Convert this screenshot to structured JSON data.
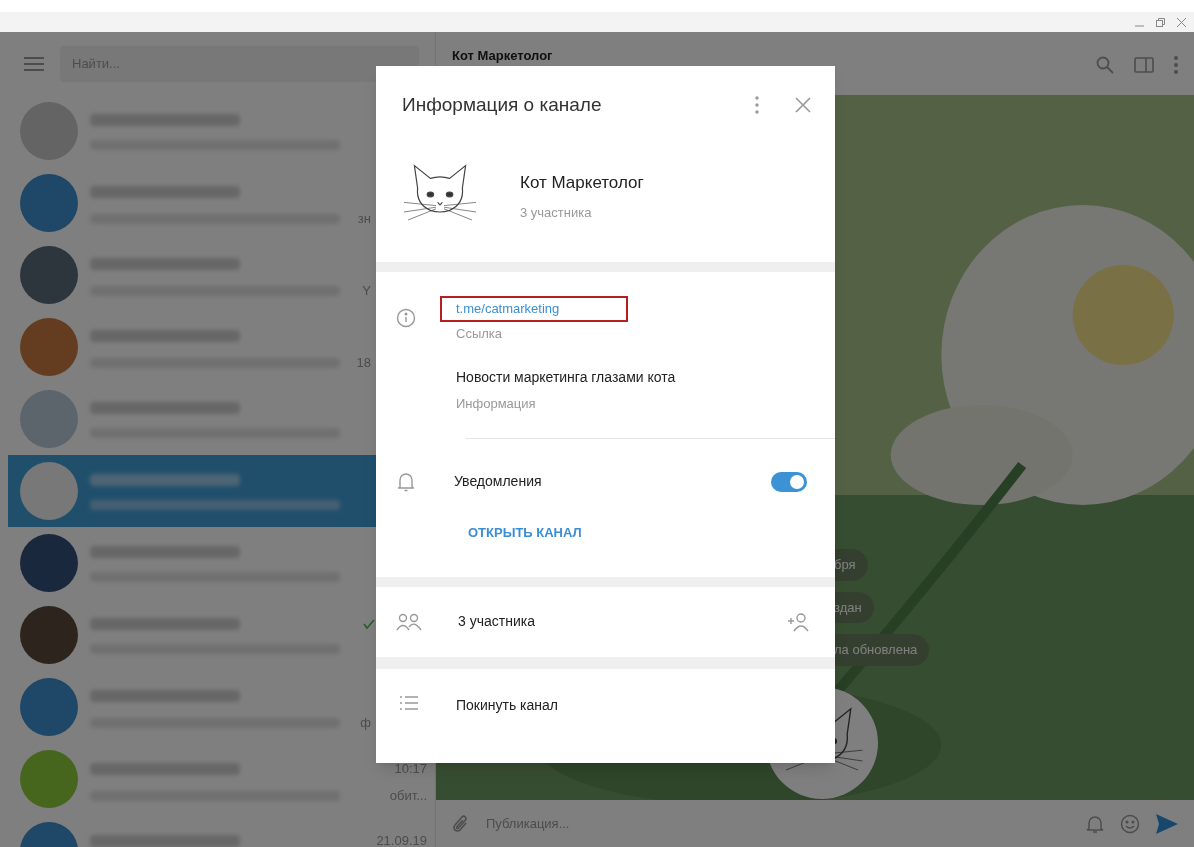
{
  "sidebar": {
    "search": {
      "placeholder": "Найти..."
    },
    "chats": [
      {
        "selected": false
      },
      {
        "selected": false,
        "snippet": "зн"
      },
      {
        "selected": false,
        "snippet": "Y"
      },
      {
        "selected": false,
        "snippet": "18"
      },
      {
        "selected": false
      },
      {
        "selected": true
      },
      {
        "selected": false
      },
      {
        "selected": false,
        "read": true
      },
      {
        "selected": false,
        "snippet": "ф"
      },
      {
        "selected": false,
        "time": "10:17",
        "snippet": "обит..."
      },
      {
        "selected": false,
        "time": "21.09.19"
      }
    ]
  },
  "chat": {
    "title": "Кот Маркетолог",
    "service_messages": [
      "бря",
      "здан",
      "ла обновлена"
    ],
    "input": {
      "placeholder": "Публикация..."
    }
  },
  "modal": {
    "title": "Информация о канале",
    "channel": {
      "name": "Кот Маркетолог",
      "subtitle": "3 участника"
    },
    "link": {
      "value": "t.me/catmarketing",
      "label": "Ссылка",
      "highlighted": true
    },
    "description": {
      "value": "Новости маркетинга глазами кота",
      "label": "Информация"
    },
    "notifications": {
      "label": "Уведомления",
      "on": true
    },
    "open_button": "ОТКРЫТЬ КАНАЛ",
    "members": "3 участника",
    "leave": "Покинуть канал"
  }
}
